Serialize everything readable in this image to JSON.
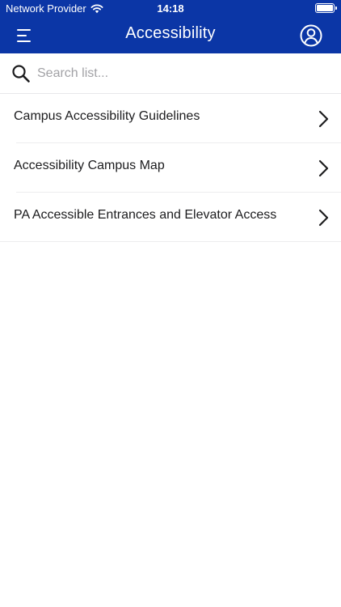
{
  "status_bar": {
    "carrier": "Network Provider",
    "time": "14:18",
    "wifi_icon": "wifi-icon",
    "battery_icon": "battery-icon"
  },
  "header": {
    "title": "Accessibility",
    "menu_icon": "menu-icon",
    "profile_icon": "profile-icon",
    "background_color": "#0b36a6"
  },
  "search": {
    "placeholder": "Search list...",
    "value": "",
    "icon": "search-icon"
  },
  "list": {
    "items": [
      {
        "label": "Campus Accessibility Guidelines"
      },
      {
        "label": "Accessibility Campus Map"
      },
      {
        "label": "PA Accessible Entrances and Elevator Access"
      }
    ]
  }
}
